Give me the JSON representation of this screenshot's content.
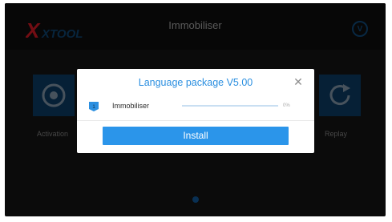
{
  "header": {
    "brand": "XTOOL",
    "title": "Immobiliser",
    "vip_icon_letter": "V"
  },
  "tiles": [
    {
      "label": "Activation",
      "icon": "target-icon"
    },
    {
      "label": "Replay",
      "icon": "refresh-icon"
    }
  ],
  "dialog": {
    "title": "Language package V5.00",
    "close_icon": "close-icon",
    "package": {
      "number": "1",
      "name": "Immobiliser",
      "progress_percent": 0,
      "progress_text": "0%"
    },
    "install_label": "Install"
  },
  "colors": {
    "accent": "#2b8fe0",
    "install_button": "#2b95ea",
    "tile_bg": "#0a3254",
    "logo_red": "#b0141e",
    "logo_blue": "#0d3e67",
    "background": "#111111"
  }
}
